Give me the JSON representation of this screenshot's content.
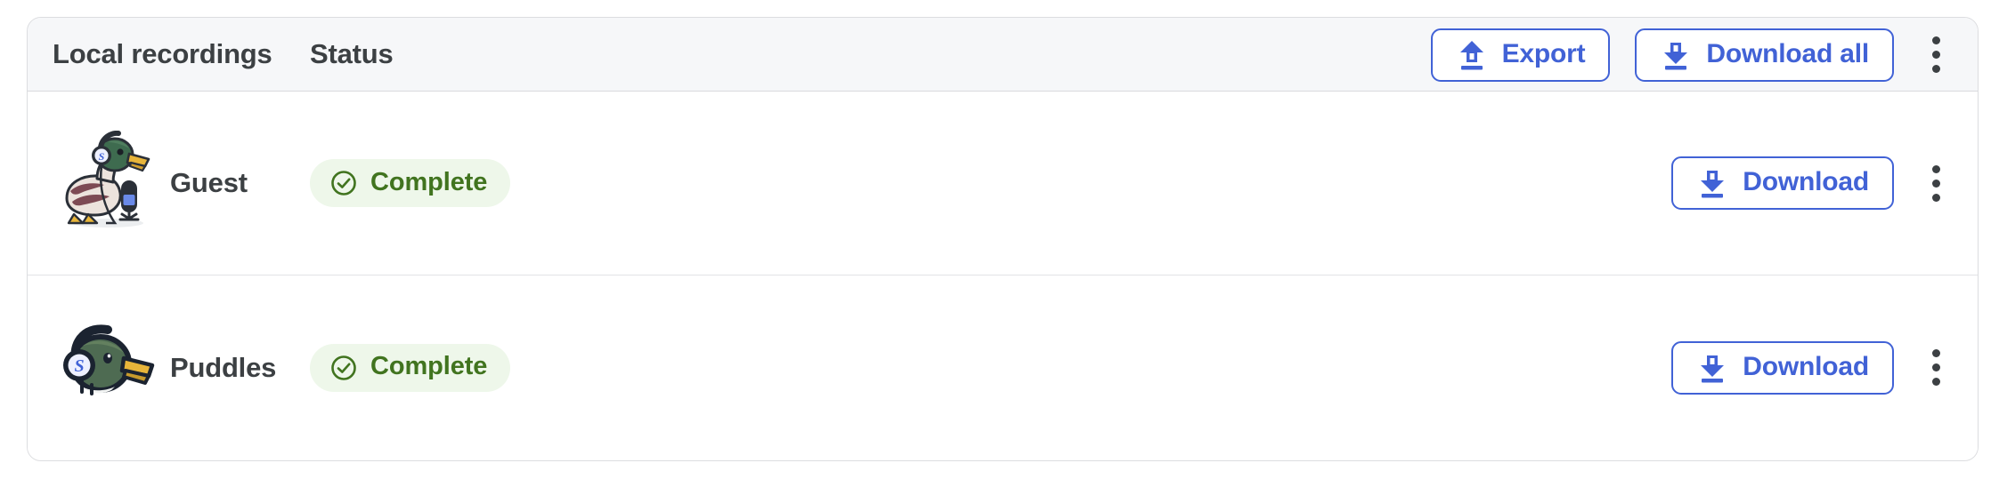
{
  "card": {
    "header": {
      "columns": {
        "name": "Local recordings",
        "status": "Status"
      },
      "actions": {
        "export_label": "Export",
        "export_icon": "upload-icon",
        "download_all_label": "Download all",
        "download_all_icon": "download-icon",
        "overflow_icon": "kebab-menu-icon"
      }
    },
    "rows": [
      {
        "name": "Guest",
        "avatar_icon": "duck-with-headphones-and-microphone-avatar",
        "status_label": "Complete",
        "status_icon": "check-circle-icon",
        "action_label": "Download",
        "action_icon": "download-icon",
        "overflow_icon": "kebab-menu-icon"
      },
      {
        "name": "Puddles",
        "avatar_icon": "duck-head-with-headphones-avatar",
        "status_label": "Complete",
        "status_icon": "check-circle-icon",
        "action_label": "Download",
        "action_icon": "download-icon",
        "overflow_icon": "kebab-menu-icon"
      }
    ]
  },
  "colors": {
    "accent_blue": "#4162d6",
    "status_green_text": "#41741f",
    "status_green_bg": "#eef7ea",
    "header_bg": "#f6f7f9",
    "card_border": "#dcdde0",
    "text_primary": "#3c4043"
  }
}
